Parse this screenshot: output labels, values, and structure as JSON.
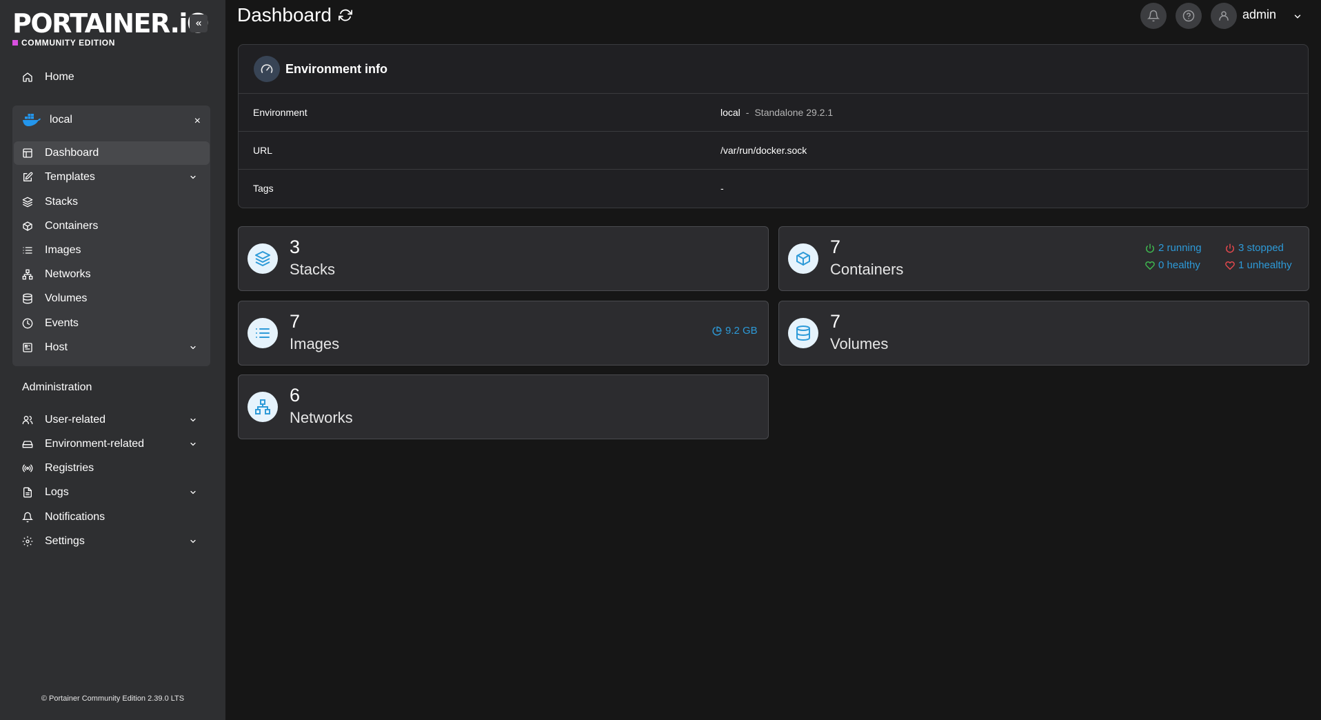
{
  "sidebar": {
    "logo_text": "PORTAINER.iO",
    "logo_sub": "COMMUNITY EDITION",
    "home": "Home",
    "environment": {
      "name": "local",
      "close": "×"
    },
    "env_items": [
      {
        "label": "Dashboard",
        "icon": "dashboard-icon"
      },
      {
        "label": "Templates",
        "icon": "edit-icon"
      },
      {
        "label": "Stacks",
        "icon": "layers-icon"
      },
      {
        "label": "Containers",
        "icon": "box-icon"
      },
      {
        "label": "Images",
        "icon": "list-icon"
      },
      {
        "label": "Networks",
        "icon": "network-icon"
      },
      {
        "label": "Volumes",
        "icon": "database-icon"
      },
      {
        "label": "Events",
        "icon": "clock-icon"
      },
      {
        "label": "Host",
        "icon": "server-icon"
      }
    ],
    "admin_title": "Administration",
    "admin_items": [
      {
        "label": "User-related",
        "icon": "users-icon"
      },
      {
        "label": "Environment-related",
        "icon": "hdd-icon"
      },
      {
        "label": "Registries",
        "icon": "radio-icon"
      },
      {
        "label": "Logs",
        "icon": "file-icon"
      },
      {
        "label": "Notifications",
        "icon": "bell-icon"
      },
      {
        "label": "Settings",
        "icon": "gear-icon"
      }
    ],
    "footer": "© Portainer Community Edition 2.39.0 LTS"
  },
  "header": {
    "title": "Dashboard",
    "user": "admin"
  },
  "env_info": {
    "title": "Environment info",
    "rows": [
      {
        "key": "Environment",
        "value": "local",
        "sep": "-",
        "detail": "Standalone 29.2.1"
      },
      {
        "key": "URL",
        "value": "/var/run/docker.sock"
      },
      {
        "key": "Tags",
        "value": "-"
      }
    ]
  },
  "cards": {
    "stacks": {
      "count": "3",
      "label": "Stacks"
    },
    "containers": {
      "count": "7",
      "label": "Containers",
      "running": "2 running",
      "stopped": "3 stopped",
      "healthy": "0 healthy",
      "unhealthy": "1 unhealthy"
    },
    "images": {
      "count": "7",
      "label": "Images",
      "size": "9.2 GB"
    },
    "volumes": {
      "count": "7",
      "label": "Volumes"
    },
    "networks": {
      "count": "6",
      "label": "Networks"
    }
  },
  "colors": {
    "accent": "#2d9ad8",
    "running": "#3fb950",
    "stopped": "#e5484d",
    "active_nav": "#48494c"
  }
}
